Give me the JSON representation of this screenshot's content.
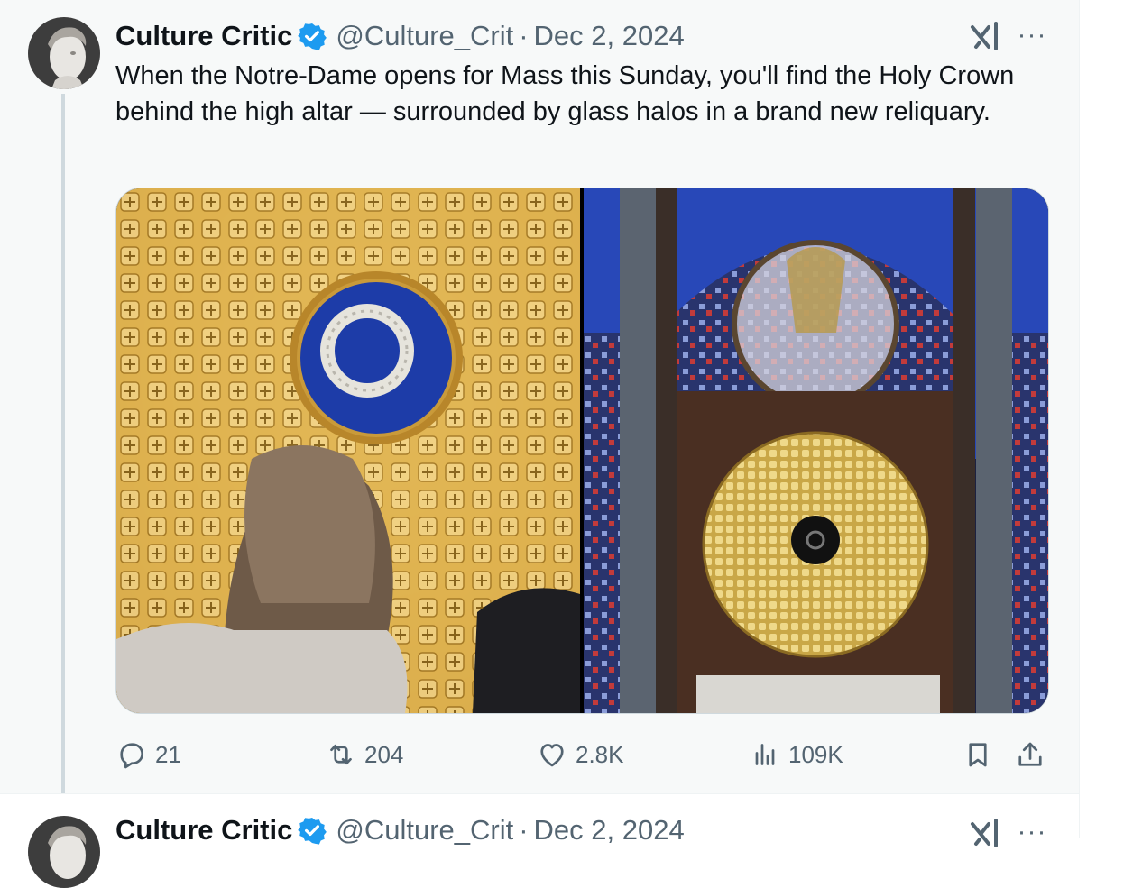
{
  "tweet": {
    "author_name": "Culture Critic",
    "handle": "@Culture_Crit",
    "separator": "·",
    "date": "Dec 2, 2024",
    "more_label": "···",
    "text": "When the Notre-Dame opens for Mass this Sunday, you'll find the Holy Crown behind the high altar — surrounded by glass halos in a brand new reliquary.",
    "media": [
      "crown-dome-photo",
      "reliquary-altar-photo"
    ],
    "actions": {
      "replies": "21",
      "reposts": "204",
      "likes": "2.8K",
      "views": "109K"
    }
  },
  "next_tweet": {
    "author_name": "Culture Critic",
    "handle": "@Culture_Crit",
    "separator": "·",
    "date": "Dec 2, 2024",
    "more_label": "···"
  },
  "colors": {
    "text": "#0f1419",
    "secondary": "#536471",
    "verified": "#1d9bf0",
    "background": "#f7f9f9"
  }
}
